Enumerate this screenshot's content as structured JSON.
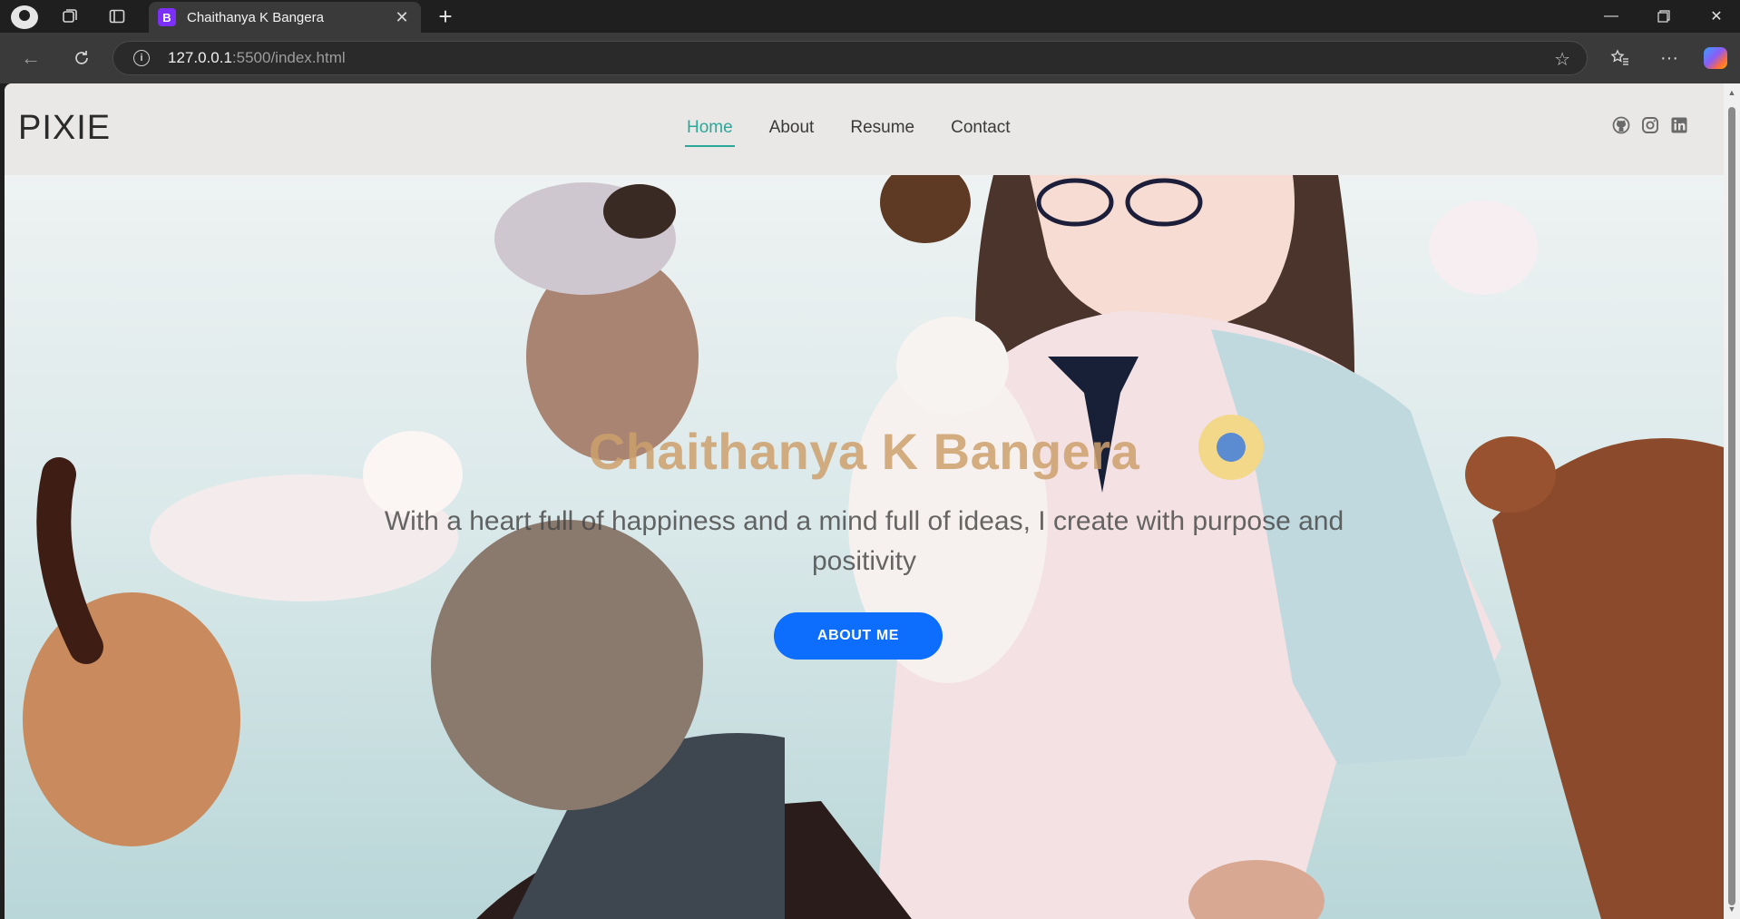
{
  "browser": {
    "tab": {
      "title": "Chaithanya K Bangera",
      "favicon_letter": "B"
    },
    "url": {
      "host": "127.0.0.1",
      "rest": ":5500/index.html"
    }
  },
  "site": {
    "logo": "PIXIE",
    "nav": [
      {
        "label": "Home",
        "active": true
      },
      {
        "label": "About",
        "active": false
      },
      {
        "label": "Resume",
        "active": false
      },
      {
        "label": "Contact",
        "active": false
      }
    ],
    "socials": [
      "github-icon",
      "instagram-icon",
      "linkedin-icon"
    ]
  },
  "hero": {
    "title": "Chaithanya K Bangera",
    "subtitle": "With a heart full of happiness and a mind full of ideas, I create with purpose and positivity",
    "button_label": "ABOUT ME"
  },
  "colors": {
    "accent": "#2ca89a",
    "button": "#0d6efd",
    "title": "#cda06c"
  }
}
